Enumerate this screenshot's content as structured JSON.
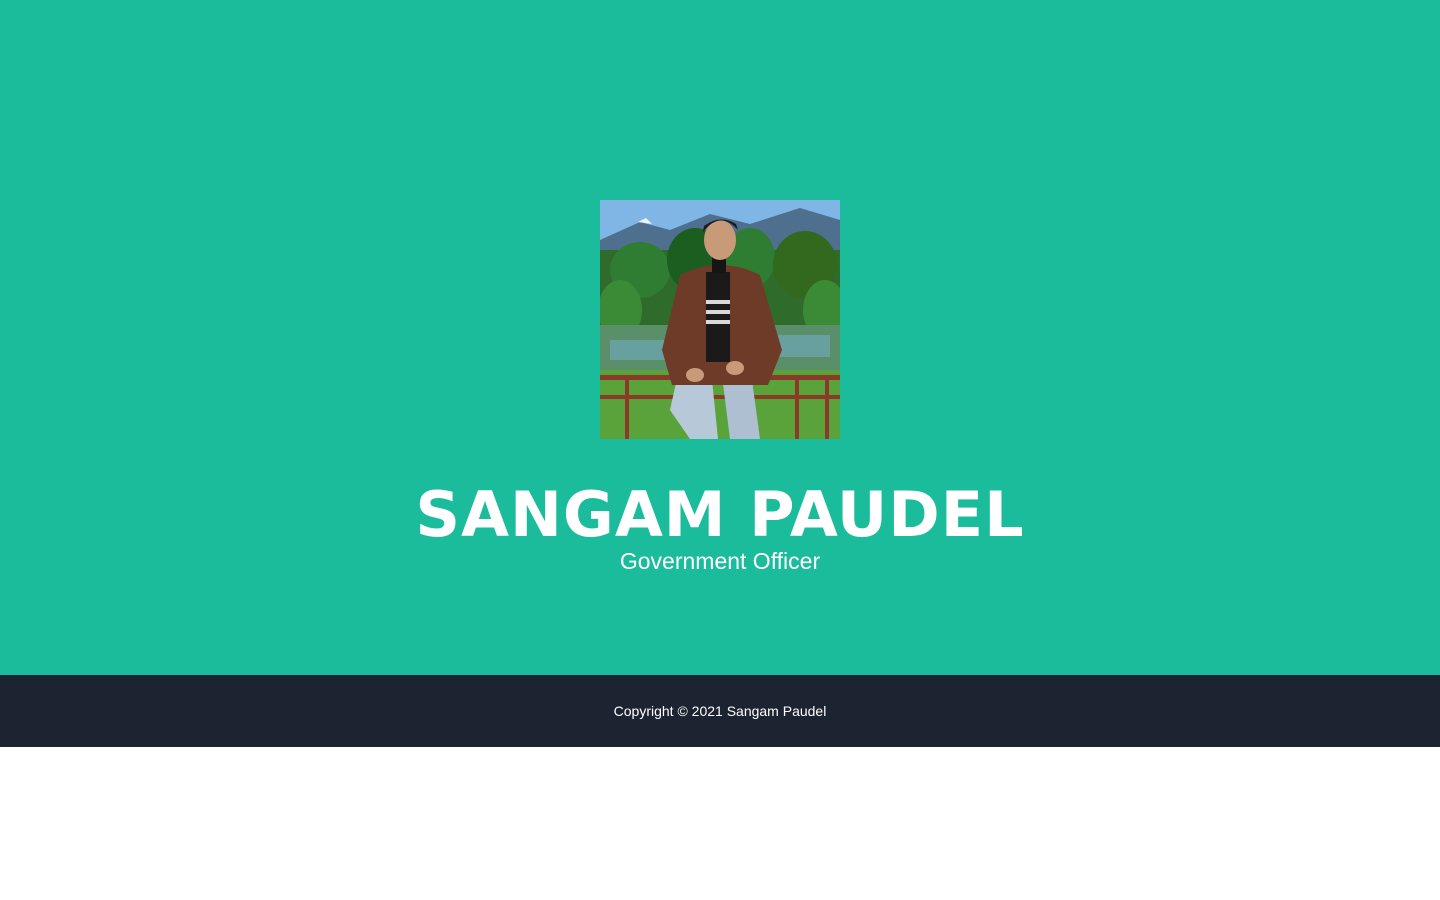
{
  "masthead": {
    "name": "SANGAM PAUDEL",
    "subtitle": "Government Officer",
    "background_color": "#1abc9c"
  },
  "profile_image": {
    "description_icon": "portrait-photo"
  },
  "footer": {
    "copyright": "Copyright © 2021 Sangam Paudel",
    "background_color": "#1c2331"
  }
}
